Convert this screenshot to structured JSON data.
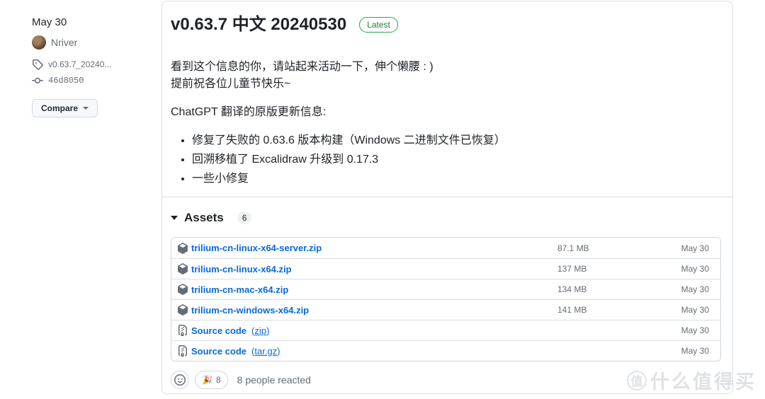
{
  "colors": {
    "link_blue": "#0969da",
    "latest_green": "#1a7f37",
    "card_border": "#d8dee4",
    "text_primary": "#1f2328",
    "text_muted": "#656d76"
  },
  "sidebar": {
    "date": "May 30",
    "author": "Nriver",
    "tag_label": "v0.63.7_20240...",
    "commit_sha": "46d8050",
    "compare_label": "Compare"
  },
  "release": {
    "title": "v0.63.7 中文 20240530",
    "latest_badge": "Latest",
    "intro_line1": "看到这个信息的你，请站起来活动一下，伸个懒腰 : )",
    "intro_line2": "提前祝各位儿童节快乐~",
    "notes_heading": "ChatGPT 翻译的原版更新信息:",
    "bullets": [
      "修复了失败的 0.63.6 版本构建（Windows 二进制文件已恢复）",
      "回溯移植了 Excalidraw 升级到 0.17.3",
      "一些小修复"
    ]
  },
  "assets": {
    "header": "Assets",
    "count": "6",
    "items": [
      {
        "name": "trilium-cn-linux-x64-server.zip",
        "suffix": "",
        "size": "87.1 MB",
        "date": "May 30",
        "icon": "package-icon"
      },
      {
        "name": "trilium-cn-linux-x64.zip",
        "suffix": "",
        "size": "137 MB",
        "date": "May 30",
        "icon": "package-icon"
      },
      {
        "name": "trilium-cn-mac-x64.zip",
        "suffix": "",
        "size": "134 MB",
        "date": "May 30",
        "icon": "package-icon"
      },
      {
        "name": "trilium-cn-windows-x64.zip",
        "suffix": "",
        "size": "141 MB",
        "date": "May 30",
        "icon": "package-icon"
      },
      {
        "name": "Source code",
        "suffix": "(zip)",
        "size": "",
        "date": "May 30",
        "icon": "file-zip-icon"
      },
      {
        "name": "Source code",
        "suffix": "(tar.gz)",
        "size": "",
        "date": "May 30",
        "icon": "file-zip-icon"
      }
    ]
  },
  "reactions": {
    "emoji": "🎉",
    "count": "8",
    "summary": "8 people reacted"
  },
  "watermark": {
    "badge": "值",
    "text": "什么值得买"
  },
  "icons": {
    "tag-icon": "octicon tag outline",
    "git-commit-icon": "octicon git-commit",
    "dropdown-caret-icon": "▾",
    "collapse-caret-icon": "▾",
    "package-icon": "octicon package cube",
    "file-zip-icon": "octicon file-zip",
    "smiley-icon": "octicon smiley",
    "tada-emoji": "🎉"
  }
}
